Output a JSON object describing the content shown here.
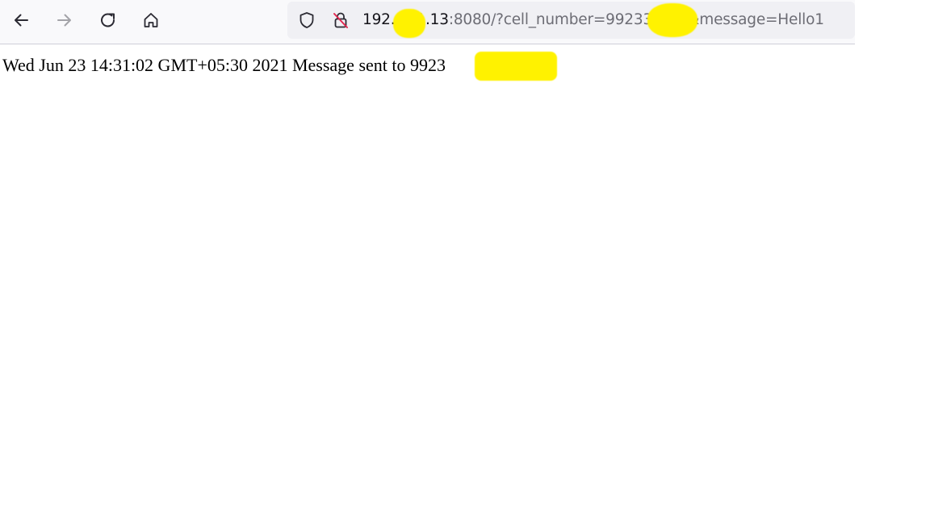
{
  "toolbar": {
    "back_icon": "arrow-left-icon",
    "forward_icon": "arrow-right-icon",
    "reload_icon": "reload-icon",
    "home_icon": "home-icon"
  },
  "urlbar": {
    "shield_icon": "shield-icon",
    "insecure_lock_icon": "lock-slash-icon",
    "host_part_1": "192.",
    "host_part_2": "1.13",
    "path_part_1": ":8080/?cell_number=99233",
    "path_part_2": "&message=Hello1"
  },
  "page": {
    "message_text": "Wed Jun 23 14:31:02 GMT+05:30 2021 Message sent to 9923"
  },
  "colors": {
    "redaction": "#fff200",
    "toolbar_bg": "#f9f9fb",
    "urlbar_bg": "#f0f0f4"
  }
}
